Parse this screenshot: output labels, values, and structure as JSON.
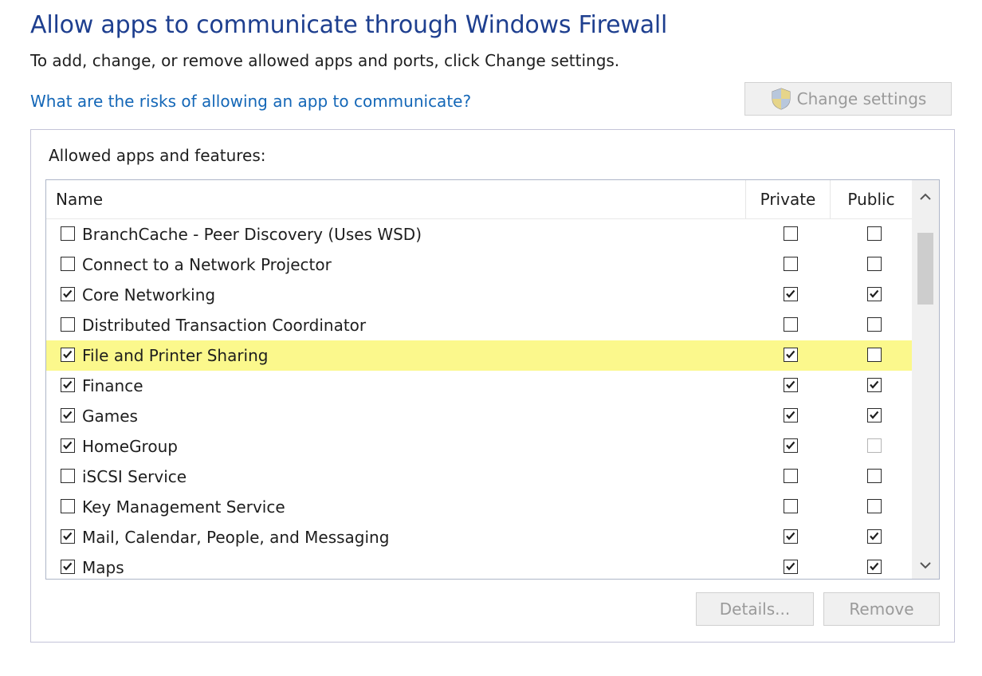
{
  "header": {
    "title": "Allow apps to communicate through Windows Firewall",
    "subtitle": "To add, change, or remove allowed apps and ports, click Change settings.",
    "risk_link": "What are the risks of allowing an app to communicate?",
    "change_settings_label": "Change settings",
    "change_settings_icon": "uac-shield-icon"
  },
  "panel": {
    "label": "Allowed apps and features:",
    "columns": {
      "name": "Name",
      "private": "Private",
      "public": "Public"
    },
    "rows": [
      {
        "label": "BranchCache - Peer Discovery (Uses WSD)",
        "enabled": false,
        "private": false,
        "public": false
      },
      {
        "label": "Connect to a Network Projector",
        "enabled": false,
        "private": false,
        "public": false
      },
      {
        "label": "Core Networking",
        "enabled": true,
        "private": true,
        "public": true
      },
      {
        "label": "Distributed Transaction Coordinator",
        "enabled": false,
        "private": false,
        "public": false
      },
      {
        "label": "File and Printer Sharing",
        "enabled": true,
        "private": true,
        "public": false,
        "highlighted": true
      },
      {
        "label": "Finance",
        "enabled": true,
        "private": true,
        "public": true
      },
      {
        "label": "Games",
        "enabled": true,
        "private": true,
        "public": true
      },
      {
        "label": "HomeGroup",
        "enabled": true,
        "private": true,
        "public": false,
        "public_dimmed": true
      },
      {
        "label": "iSCSI Service",
        "enabled": false,
        "private": false,
        "public": false
      },
      {
        "label": "Key Management Service",
        "enabled": false,
        "private": false,
        "public": false
      },
      {
        "label": "Mail, Calendar, People, and Messaging",
        "enabled": true,
        "private": true,
        "public": true
      },
      {
        "label": "Maps",
        "enabled": true,
        "private": true,
        "public": true
      }
    ],
    "details_label": "Details...",
    "remove_label": "Remove"
  },
  "colors": {
    "title": "#1e3f8f",
    "link": "#1467b7",
    "highlight": "#fbf88c",
    "disabled_text": "#9a9a9a"
  }
}
